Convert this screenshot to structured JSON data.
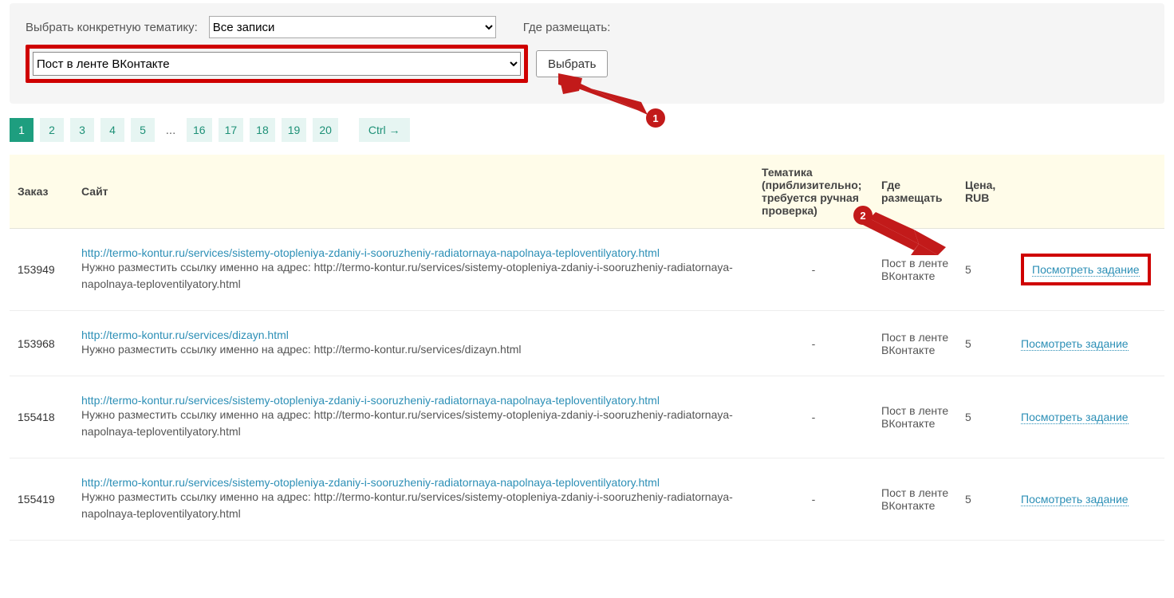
{
  "filter": {
    "topic_label": "Выбрать конкретную тематику:",
    "topic_value": "Все записи",
    "where_label": "Где размещать:",
    "place_value": "Пост в ленте ВКонтакте",
    "select_btn": "Выбрать"
  },
  "callouts": {
    "c1": "1",
    "c2": "2"
  },
  "pagination": {
    "pages_a": [
      "1",
      "2",
      "3",
      "4",
      "5"
    ],
    "ellipsis": "...",
    "pages_b": [
      "16",
      "17",
      "18",
      "19",
      "20"
    ],
    "ctrl": "Ctrl →"
  },
  "table": {
    "headers": {
      "order": "Заказ",
      "site": "Сайт",
      "thema": "Тематика (приблизительно; требуется ручная проверка)",
      "place": "Где размещать",
      "price": "Цена, RUB",
      "action": ""
    },
    "view_label": "Посмотреть задание",
    "rows": [
      {
        "order": "153949",
        "url": "http://termo-kontur.ru/services/sistemy-otopleniya-zdaniy-i-sooruzheniy-radiatornaya-napolnaya-teploventilyatory.html",
        "note": "Нужно разместить ссылку именно на адрес: http://termo-kontur.ru/services/sistemy-otopleniya-zdaniy-i-sooruzheniy-radiatornaya-napolnaya-teploventilyatory.html",
        "thema": "-",
        "place": "Пост в ленте ВКонтакте",
        "price": "5",
        "highlight": true
      },
      {
        "order": "153968",
        "url": "http://termo-kontur.ru/services/dizayn.html",
        "note": "Нужно разместить ссылку именно на адрес: http://termo-kontur.ru/services/dizayn.html",
        "thema": "-",
        "place": "Пост в ленте ВКонтакте",
        "price": "5",
        "highlight": false
      },
      {
        "order": "155418",
        "url": "http://termo-kontur.ru/services/sistemy-otopleniya-zdaniy-i-sooruzheniy-radiatornaya-napolnaya-teploventilyatory.html",
        "note": "Нужно разместить ссылку именно на адрес: http://termo-kontur.ru/services/sistemy-otopleniya-zdaniy-i-sooruzheniy-radiatornaya-napolnaya-teploventilyatory.html",
        "thema": "-",
        "place": "Пост в ленте ВКонтакте",
        "price": "5",
        "highlight": false
      },
      {
        "order": "155419",
        "url": "http://termo-kontur.ru/services/sistemy-otopleniya-zdaniy-i-sooruzheniy-radiatornaya-napolnaya-teploventilyatory.html",
        "note": "Нужно разместить ссылку именно на адрес: http://termo-kontur.ru/services/sistemy-otopleniya-zdaniy-i-sooruzheniy-radiatornaya-napolnaya-teploventilyatory.html",
        "thema": "-",
        "place": "Пост в ленте ВКонтакте",
        "price": "5",
        "highlight": false
      }
    ]
  }
}
